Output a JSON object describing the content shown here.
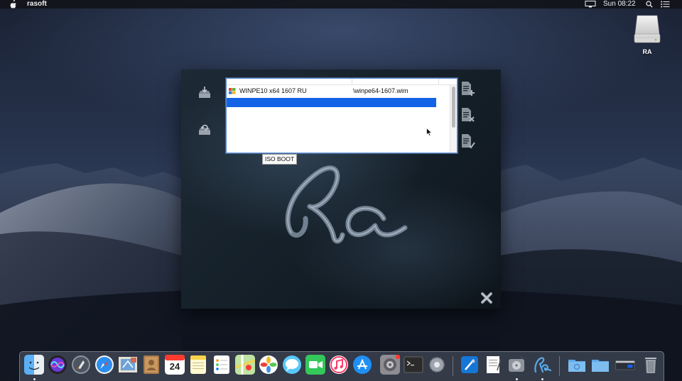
{
  "menubar": {
    "app_name": "rasoft",
    "clock": "Sun 08:22"
  },
  "desktop": {
    "drive_label": "RA"
  },
  "ra_window": {
    "image_list": {
      "rows": [
        {
          "name": "WINPE10 x64 1607 RU",
          "path": "\\winpe64-1607.wim",
          "icon": "windows-logo-icon"
        },
        {
          "name": "",
          "path": "",
          "selected": true
        }
      ]
    },
    "iso_boot_label": "ISO BOOT"
  },
  "dock": {
    "calendar_day": "24",
    "items": [
      "finder-icon",
      "siri-icon",
      "launchpad-icon",
      "safari-icon",
      "mail-icon",
      "contacts-icon",
      "calendar-icon",
      "notes-icon",
      "reminders-icon",
      "maps-icon",
      "photos-icon",
      "messages-icon",
      "facetime-icon",
      "itunes-icon",
      "app-store-icon",
      "system-preferences-icon",
      "terminal-icon",
      "settings-gear-icon",
      "xcode-icon",
      "textedit-icon",
      "disk-utility-icon",
      "ra-app-icon",
      "folder-icon",
      "downloads-folder-icon",
      "window-icon",
      "trash-icon"
    ]
  },
  "colors": {
    "selection": "#1463e6",
    "menubar": "#12141a"
  }
}
